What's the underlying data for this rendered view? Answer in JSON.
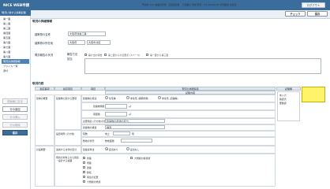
{
  "app": {
    "title": "NICE WEB申請",
    "logout": "ログアウト"
  },
  "sidebar": {
    "header": "現況に関する情報記載",
    "items": [
      "第一面",
      "第二面",
      "第三面",
      "第四面",
      "第五面",
      "第六面",
      "第七面",
      "第八面",
      "第九面",
      "現況の詳細情報",
      "ファイル一覧",
      "添付"
    ],
    "active_index": 9,
    "buttons": {
      "prev": "前画面に戻る",
      "add": "行の追加",
      "insert": "行の挿入",
      "delete": "行の削除",
      "save": "保存"
    }
  },
  "header": {
    "text": "申請中 1/10 事業者登録・変更届出書 　行政書士 登録 現況 · 1/1 (R6/02/28) 状況確認 未提出",
    "check": "チェック",
    "save": "保存"
  },
  "form": {
    "section_title": "現況の詳細情報",
    "rows": [
      {
        "label": "建築物の名称",
        "value": "大阪府建築工事"
      },
      {
        "label": "建築物の所在地",
        "value1": "大阪府",
        "value2": "大阪市北区"
      }
    ],
    "report_label": "現況報告の状況",
    "report_sub": "報告方法",
    "report_note": "該当",
    "checkbox_labels": [
      "届け出の報告",
      "第二面からの変更点 (スペース)",
      "第一面から第三面"
    ]
  },
  "table": {
    "title": "現況内容",
    "headers": [
      "指定事項",
      "指定項目",
      "項目",
      "現況の詳細情報",
      "記載内容",
      "記載欄"
    ],
    "sub_headers": [
      "区分",
      "内容",
      "入力方法",
      "補足"
    ],
    "rows": [
      {
        "c1": "建物の概要",
        "c2": "建築物に関する要項",
        "item": "建築物の用途",
        "opt1": "住宅等",
        "opt2": "非住宅 (事務所用)",
        "opt3": "非住宅 (店舗等)"
      },
      {
        "item": "建築物規模",
        "unit": "㎡"
      },
      {
        "item": "床面積",
        "unit": "㎡"
      },
      {
        "item": "主要用途 (その他)の区分",
        "detail": "建築物の用途の区分"
      },
      {
        "item": "建築物の構造",
        "detail": "構造"
      },
      {
        "item": "階数",
        "detail": "地上",
        "unit": "階"
      },
      {
        "c2": "設置場所 (その他)",
        "item": "敷地の状況",
        "detail": "敷地面積"
      },
      {
        "c1": "計画概要",
        "c2": "適用する法律の区分",
        "item": "建築基準法",
        "opts": [
          "該当あり",
          "該当なし"
        ]
      },
      {
        "item": "申請の対象となる用途 ・設計する範囲",
        "opts": [
          "新築",
          "増築",
          "改築",
          "移転",
          "用途の変更",
          "大規模の修繕",
          "大規模の模様替"
        ]
      }
    ],
    "side_list": [
      "未入力",
      "確認済",
      "要確認"
    ]
  },
  "colors": {
    "primary": "#3a6c9c",
    "yellow": "#fff36b"
  }
}
